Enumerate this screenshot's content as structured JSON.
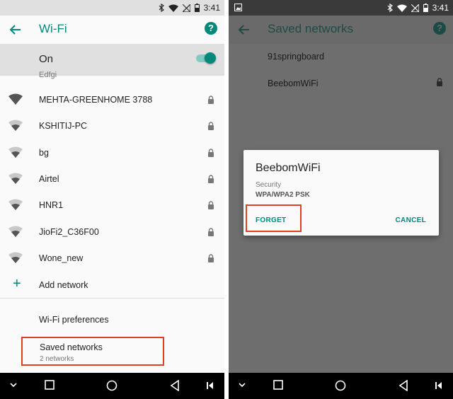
{
  "status_bar": {
    "time": "3:41"
  },
  "left": {
    "app_bar": {
      "title": "Wi-Fi"
    },
    "toggle_row": {
      "label": "On",
      "enabled": true
    },
    "partial_network_text": "Edfgi",
    "networks": [
      {
        "name": "MEHTA-GREENHOME 3788",
        "secured": true
      },
      {
        "name": "KSHITIJ-PC",
        "secured": true
      },
      {
        "name": "bg",
        "secured": true
      },
      {
        "name": "Airtel",
        "secured": true
      },
      {
        "name": "HNR1",
        "secured": true
      },
      {
        "name": "JioFi2_C36F00",
        "secured": true
      },
      {
        "name": "Wone_new",
        "secured": true
      }
    ],
    "add_network_label": "Add network",
    "wifi_preferences_label": "Wi-Fi preferences",
    "saved_networks": {
      "title": "Saved networks",
      "subtitle": "2 networks"
    }
  },
  "right": {
    "app_bar": {
      "title": "Saved networks"
    },
    "saved_list": [
      {
        "name": "91springboard",
        "secured": false
      },
      {
        "name": "BeebomWiFi",
        "secured": true
      }
    ],
    "dialog": {
      "title": "BeebomWiFi",
      "security_label": "Security",
      "security_value": "WPA/WPA2 PSK",
      "forget_label": "FORGET",
      "cancel_label": "CANCEL"
    }
  },
  "colors": {
    "accent": "#00897b",
    "highlight": "#e0401a"
  }
}
